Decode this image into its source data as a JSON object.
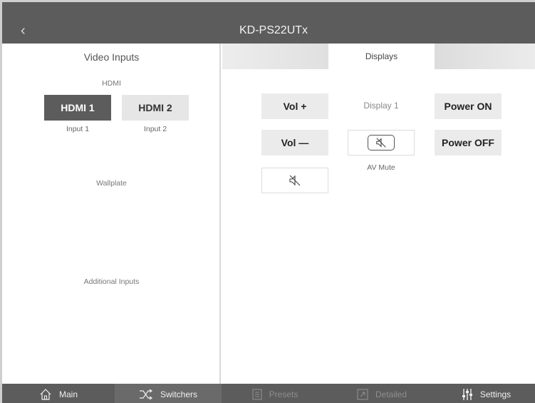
{
  "header": {
    "back_icon": "chevron-left-icon",
    "title": "KD-PS22UTx"
  },
  "left_panel": {
    "title": "Video Inputs",
    "hdmi_group": "HDMI",
    "sources": [
      {
        "label": "HDMI 1",
        "sub": "Input 1",
        "active": true
      },
      {
        "label": "HDMI 2",
        "sub": "Input 2",
        "active": false
      }
    ],
    "wallplate": "Wallplate",
    "additional": "Additional Inputs"
  },
  "tabs": {
    "active": "Displays"
  },
  "controls": {
    "vol_up": "Vol +",
    "vol_down": "Vol —",
    "display_label": "Display 1",
    "power_on": "Power ON",
    "power_off": "Power OFF",
    "av_mute_label": "AV Mute",
    "mute_icon": "speaker-mute-icon"
  },
  "bottom_nav": [
    {
      "label": "Main",
      "icon": "home-icon"
    },
    {
      "label": "Switchers",
      "icon": "shuffle-icon"
    },
    {
      "label": "Presets",
      "icon": "list-icon"
    },
    {
      "label": "Detailed",
      "icon": "expand-icon"
    },
    {
      "label": "Settings",
      "icon": "sliders-icon"
    }
  ],
  "colors": {
    "dark": "#5c5c5c",
    "button": "#ebebeb",
    "active_button": "#5c5c5c"
  }
}
